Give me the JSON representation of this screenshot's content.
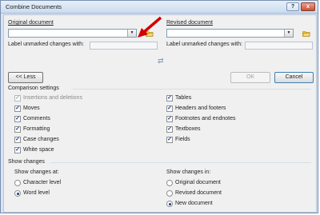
{
  "window": {
    "title": "Combine Documents",
    "help_label": "?",
    "close_label": "x"
  },
  "original": {
    "label": "Original document",
    "value": "",
    "unmarked_label": "Label unmarked changes with:",
    "unmarked_value": ""
  },
  "revised": {
    "label": "Revised document",
    "value": "",
    "unmarked_label": "Label unmarked changes with:",
    "unmarked_value": ""
  },
  "buttons": {
    "less": "<< Less",
    "ok": "OK",
    "cancel": "Cancel"
  },
  "comparison": {
    "header": "Comparison settings",
    "left": [
      {
        "label": "Insertions and deletions",
        "checked": true,
        "disabled": true
      },
      {
        "label": "Moves",
        "checked": true,
        "disabled": false
      },
      {
        "label": "Comments",
        "checked": true,
        "disabled": false
      },
      {
        "label": "Formatting",
        "checked": true,
        "disabled": false
      },
      {
        "label": "Case changes",
        "checked": true,
        "disabled": false
      },
      {
        "label": "White space",
        "checked": true,
        "disabled": false
      }
    ],
    "right": [
      {
        "label": "Tables",
        "checked": true
      },
      {
        "label": "Headers and footers",
        "checked": true
      },
      {
        "label": "Footnotes and endnotes",
        "checked": true
      },
      {
        "label": "Textboxes",
        "checked": true
      },
      {
        "label": "Fields",
        "checked": true
      }
    ]
  },
  "show_changes": {
    "header": "Show changes",
    "at_label": "Show changes at:",
    "at_options": [
      {
        "label": "Character level",
        "selected": false
      },
      {
        "label": "Word level",
        "selected": true
      }
    ],
    "in_label": "Show changes in:",
    "in_options": [
      {
        "label": "Original document",
        "selected": false
      },
      {
        "label": "Revised document",
        "selected": false
      },
      {
        "label": "New document",
        "selected": true
      }
    ]
  },
  "annotation": {
    "arrow_color": "#d40000"
  },
  "glyphs": {
    "check": "✓",
    "dropdown": "▼",
    "swap": "⇄"
  }
}
